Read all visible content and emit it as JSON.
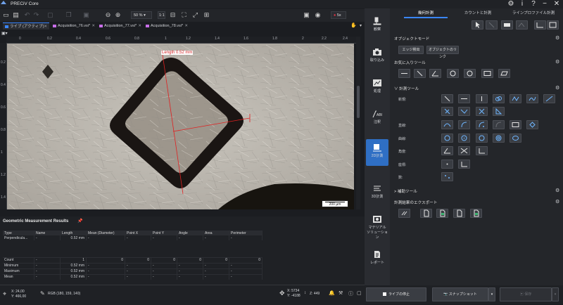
{
  "app": {
    "title": "PRECiV Core"
  },
  "toolbar": {
    "zoom": "50 %",
    "ratio": "1:1",
    "fps": "5x"
  },
  "tabs": [
    {
      "label": "ライブ (アクティブ)",
      "color": "#3a86ff"
    },
    {
      "label": "Acquisition_76.vsi*",
      "color": "#c86ee8"
    },
    {
      "label": "Acquisition_77.vsi*",
      "color": "#c86ee8"
    },
    {
      "label": "Acquisition_78.vsi*",
      "color": "#c86ee8"
    }
  ],
  "ruler_top": [
    "0",
    "0.2",
    "0.4",
    "0.6",
    "0.8",
    "1",
    "1.2",
    "1.4",
    "1.6",
    "1.8",
    "2",
    "2.2",
    "2.4"
  ],
  "ruler_left": [
    "0.2",
    "0.4",
    "0.6",
    "0.8",
    "1",
    "1.2",
    "1.4"
  ],
  "image": {
    "measure_label": "Length 0.52 mm",
    "scalebar": "200 µm"
  },
  "results": {
    "title": "Geometric Measurement Results",
    "columns": [
      "Type",
      "Name",
      "Length",
      "Mean (Diameter)",
      "Point X",
      "Point Y",
      "Angle",
      "Area",
      "Perimeter"
    ],
    "row": [
      "Perpendicula...",
      "-",
      "0.52 mm",
      "-",
      "-",
      "-",
      "-",
      "-",
      "-"
    ],
    "stats": [
      [
        "Count",
        "-",
        "1",
        "0",
        "0",
        "0",
        "0",
        "0",
        "0"
      ],
      [
        "Minimum",
        "-",
        "0.52 mm",
        "-",
        "-",
        "-",
        "-",
        "-",
        "-"
      ],
      [
        "Maximum",
        "-",
        "0.52 mm",
        "-",
        "-",
        "-",
        "-",
        "-",
        "-"
      ],
      [
        "Mean",
        "-",
        "0.52 mm",
        "-",
        "-",
        "-",
        "-",
        "-",
        "-"
      ]
    ]
  },
  "status": {
    "x": "X: 24,00",
    "y": "Y: 466,00",
    "rgb": "RGB (180, 159, 140)",
    "stage_x": "X: 5734",
    "stage_y": "Y: -4188",
    "z": "Z: 449"
  },
  "sidebar": [
    {
      "label": "観察"
    },
    {
      "label": "取り込み"
    },
    {
      "label": "処理"
    },
    {
      "label": "注釈"
    },
    {
      "label": "2D計測"
    },
    {
      "label": "3D計測"
    },
    {
      "label": "マテリアル\nソリューション"
    },
    {
      "label": "レポート"
    }
  ],
  "right_tabs": [
    "幾何計測",
    "カウントと計測",
    "ラインプロファイル計測"
  ],
  "right": {
    "object_mode": "オブジェクトモード",
    "edge_detect": "エッジ検出",
    "object_link": "オブジェクトのリンク",
    "favorites": "お気に入りツール",
    "measure_tools": "計測ツール",
    "groups": [
      "新規:",
      "直線:",
      "曲線:",
      "角度:",
      "座標:",
      "数:"
    ],
    "aux": "補助ツール",
    "export": "計測結果のエクスポート"
  },
  "bottom": {
    "stop_live": "ライブの停止",
    "snapshot": "スナップショット",
    "save": "保存"
  }
}
